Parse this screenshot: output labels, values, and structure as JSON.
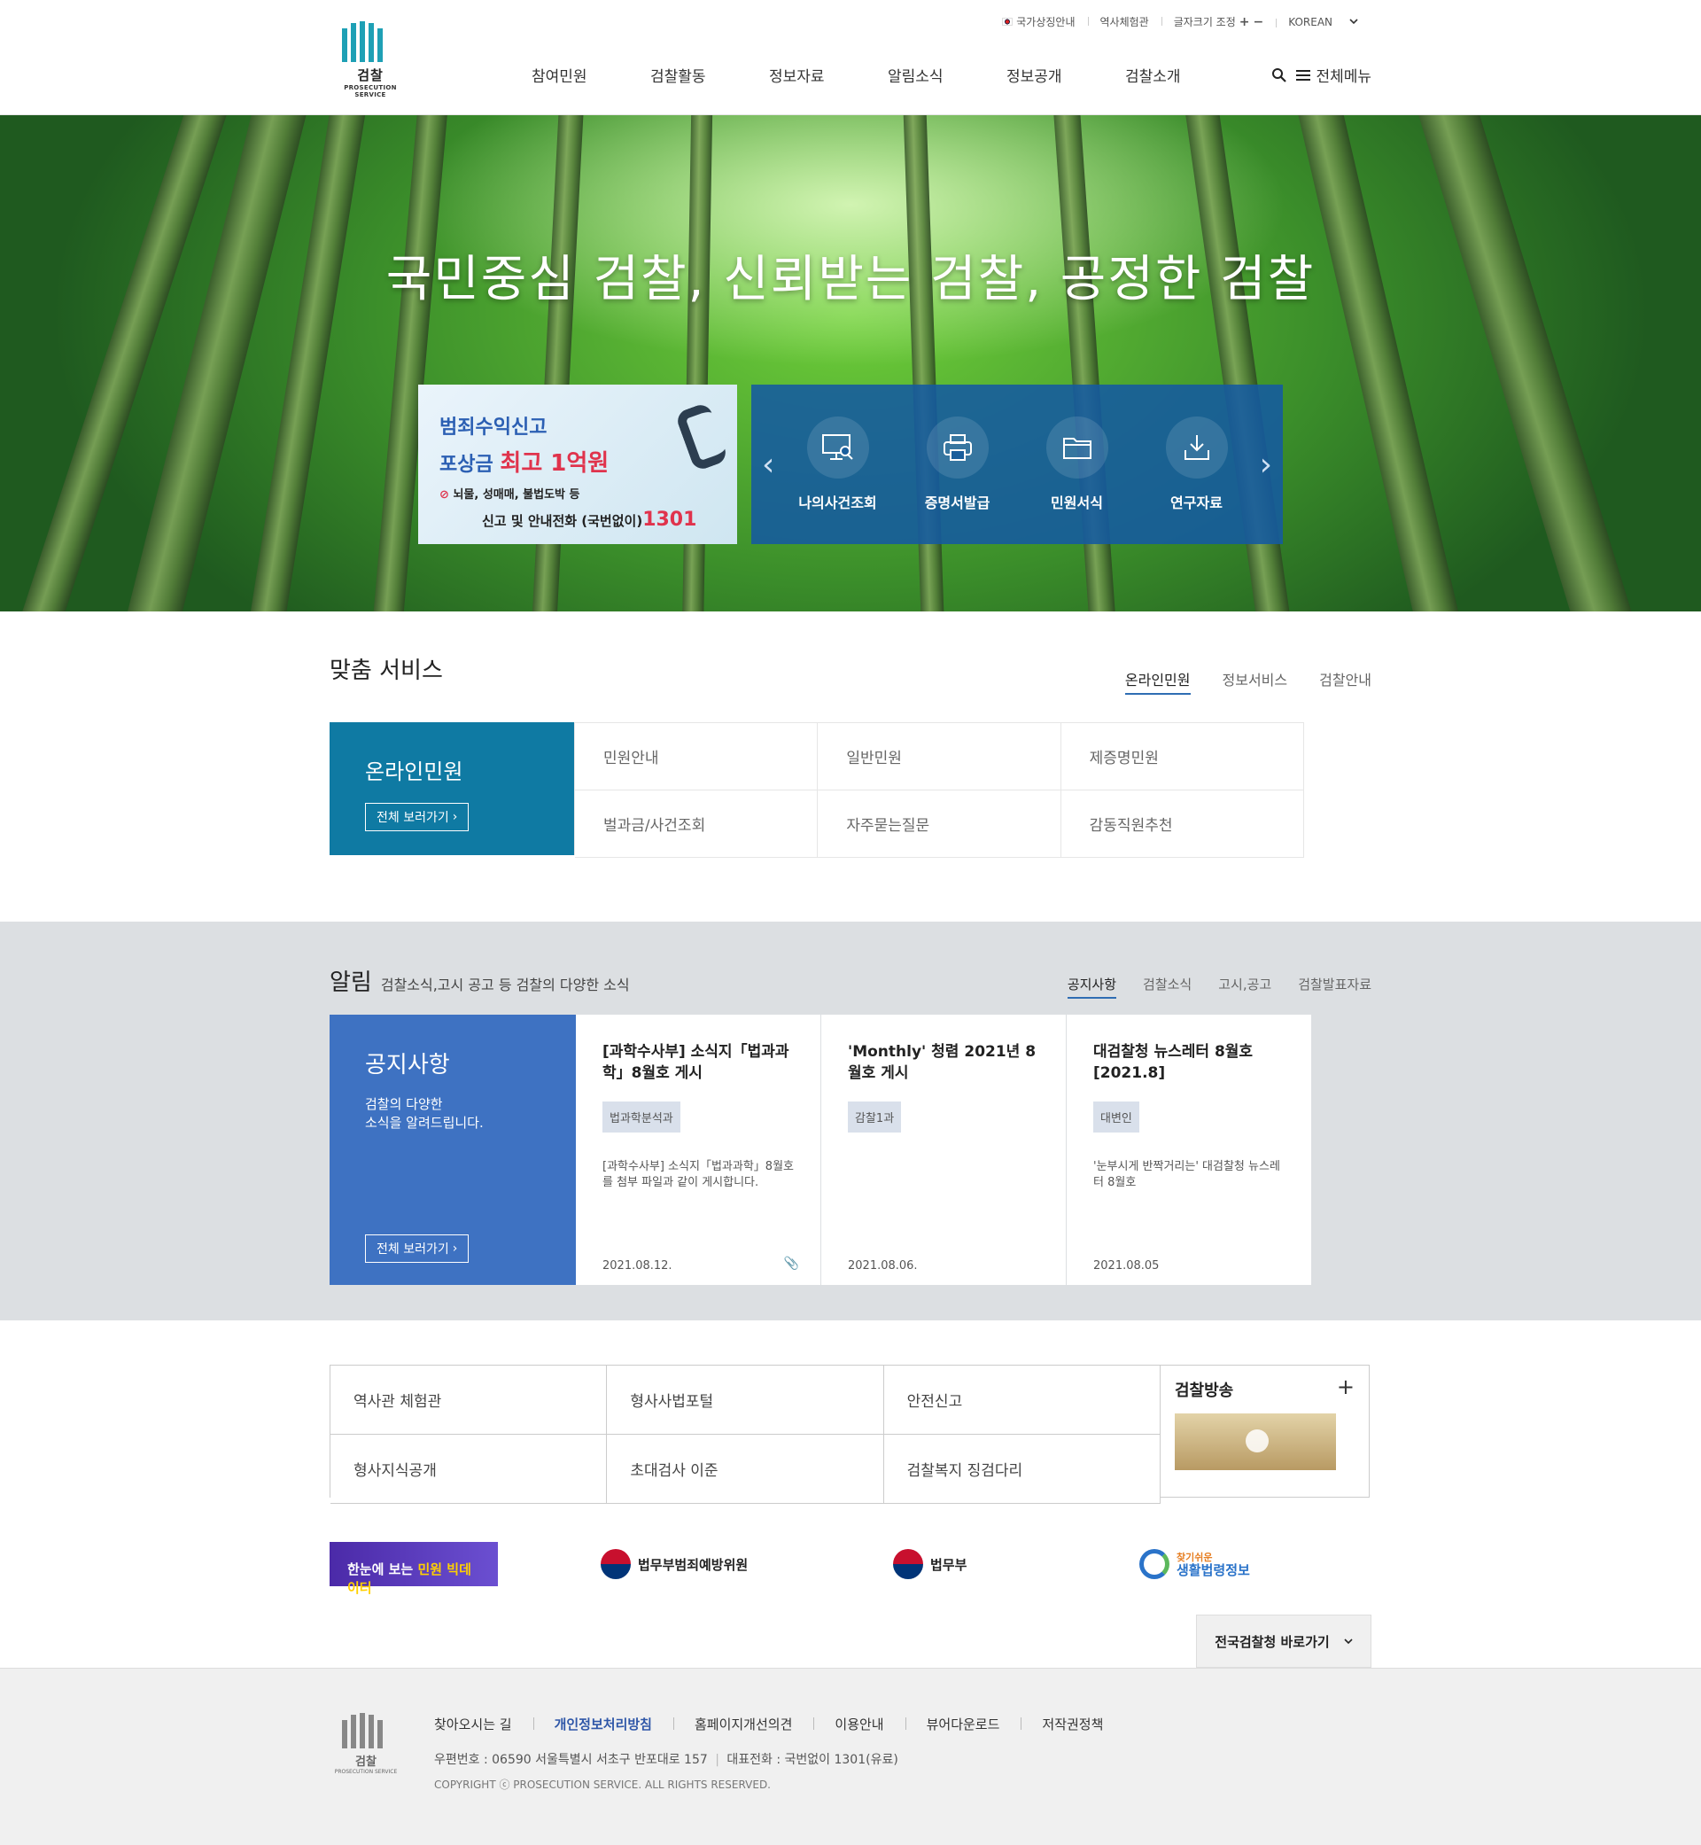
{
  "header": {
    "logo_name": "검찰",
    "logo_sub": "PROSECUTION SERVICE",
    "util": [
      "국가상징안내",
      "역사체험관",
      "글자크기 조정",
      "KOREAN"
    ],
    "gnb": [
      "참여민원",
      "검찰활동",
      "정보자료",
      "알림소식",
      "정보공개",
      "검찰소개"
    ],
    "all_menu": "전체메뉴"
  },
  "hero": {
    "slogan": "국민중심 검찰, 신뢰받는 검찰, 공정한 검찰",
    "banner": {
      "line1": "범죄수익신고",
      "line2_prefix": "포상금",
      "line2_highlight": "최고 1억원",
      "line3": "뇌물, 성매매, 불법도박 등",
      "line4_prefix": "신고 및 안내전화 (국번없이)",
      "line4_highlight": "1301"
    },
    "quick_links": [
      "나의사건조회",
      "증명서발급",
      "민원서식",
      "연구자료"
    ]
  },
  "custom_service": {
    "title": "맞춤 서비스",
    "tabs": [
      "온라인민원",
      "정보서비스",
      "검찰안내"
    ],
    "main_title": "온라인민원",
    "view_all": "전체 보러가기",
    "items": [
      "민원안내",
      "일반민원",
      "제증명민원",
      "벌과금/사건조회",
      "자주묻는질문",
      "감동직원추천"
    ]
  },
  "notice": {
    "title": "알림",
    "subtitle": "검찰소식,고시 공고 등 검찰의 다양한 소식",
    "tabs": [
      "공지사항",
      "검찰소식",
      "고시,공고",
      "검찰발표자료"
    ],
    "main_title": "공지사항",
    "main_desc_1": "검찰의 다양한",
    "main_desc_2": "소식을 알려드립니다.",
    "view_all": "전체 보러가기",
    "cards": [
      {
        "title": "[과학수사부] 소식지「법과과학」8월호 게시",
        "tag": "법과학분석과",
        "body": "[과학수사부] 소식지「법과과학」8월호를 첨부 파일과 같이 게시합니다.",
        "date": "2021.08.12."
      },
      {
        "title": "'Monthly' 청렴 2021년 8월호 게시",
        "tag": "감찰1과",
        "body": "",
        "date": "2021.08.06."
      },
      {
        "title": "대검찰청 뉴스레터 8월호 [2021.8]",
        "tag": "대변인",
        "body": "'눈부시게 반짝거리는' 대검찰청 뉴스레터 8월호",
        "date": "2021.08.05"
      }
    ]
  },
  "links": {
    "items": [
      "역사관 체험관",
      "형사사법포털",
      "안전신고",
      "형사지식공개",
      "초대검사 이준",
      "검찰복지 징검다리"
    ],
    "broadcast_title": "검찰방송"
  },
  "partners": {
    "bigdata_prefix": "한눈에 보는",
    "bigdata_highlight": "민원 빅데이터",
    "p2": "법무부범죄예방위원",
    "p3": "법무부",
    "p4_top": "찾기쉬운",
    "p4_bottom": "생활법령정보"
  },
  "shortcut": "전국검찰청 바로가기",
  "footer": {
    "links": [
      "찾아오시는 길",
      "개인정보처리방침",
      "홈페이지개선의견",
      "이용안내",
      "뷰어다운로드",
      "저작권정책"
    ],
    "address": "우편번호 : 06590 서울특별시 서초구 반포대로 157",
    "phone": "대표전화 : 국번없이 1301(유료)",
    "copyright": "COPYRIGHT ⓒ PROSECUTION SERVICE. ALL RIGHTS RESERVED."
  }
}
